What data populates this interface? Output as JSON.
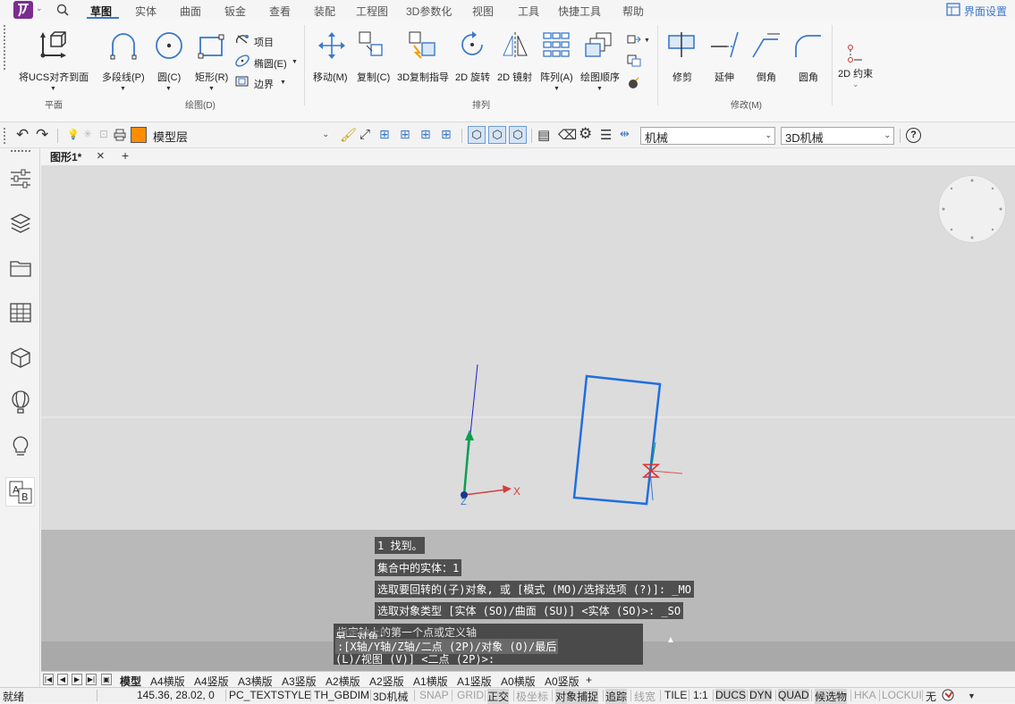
{
  "menu": {
    "items": [
      "草图",
      "实体",
      "曲面",
      "钣金",
      "查看",
      "装配",
      "工程图",
      "3D参数化",
      "视图",
      "工具",
      "快捷工具",
      "帮助"
    ],
    "settings": "界面设置"
  },
  "ribbon": {
    "ucs": "将UCS对齐到面",
    "polyline": "多段线(P)",
    "circle": "圆(C)",
    "rect": "矩形(R)",
    "item": "项目",
    "ellipse": "椭圆(E)",
    "boundary": "边界",
    "move": "移动(M)",
    "copy": "复制(C)",
    "copy3d": "3D复制指导",
    "rotate2d": "2D 旋转",
    "mirror2d": "2D 镜射",
    "array": "阵列(A)",
    "draworder": "绘图顺序",
    "trim": "修剪",
    "extend": "延伸",
    "chamfer": "倒角",
    "fillet": "圆角",
    "constraint": "2D 约束",
    "group_plane": "平面",
    "group_draw": "绘图(D)",
    "group_arrange": "排列",
    "group_modify": "修改(M)"
  },
  "toolbar": {
    "layer": "模型层",
    "style": "机械",
    "visual": "3D机械"
  },
  "doc_tabs": {
    "active": "图形1*",
    "close": "×",
    "add": "+"
  },
  "canvas": {
    "axis_x": "X",
    "axis_z": "Z"
  },
  "command": {
    "lines": [
      "1 找到。",
      "集合中的实体：1",
      "选取要回转的(子)对象, 或 [模式 (MO)/选择选项 (?)]: _MO",
      "选取对象类型 [实体 (SO)/曲面 (SU)] <实体 (SO)>: _SO"
    ],
    "prompt_line1": "指定轴上的第一个点或定义轴",
    "prompt_line2": "另一对角:",
    "prompt_line3": ":[X轴/Y轴/Z轴/二点 (2P)/对象 (O)/最后",
    "prompt_line4": "(L)/视图 (V)] <二点 (2P)>:",
    "expand_arrow": "▲"
  },
  "layouts": {
    "tabs": [
      "模型",
      "A4横版",
      "A4竖版",
      "A3横版",
      "A3竖版",
      "A2横版",
      "A2竖版",
      "A1横版",
      "A1竖版",
      "A0横版",
      "A0竖版"
    ],
    "add": "+"
  },
  "status": {
    "ready": "就绪",
    "coords": "145.36, 28.02, 0",
    "textstyle": "PC_TEXTSTYLE",
    "dimstyle": "TH_GBDIM",
    "visual": "3D机械",
    "snap": "SNAP",
    "grid": "GRID",
    "ortho": "正交",
    "polar": "极坐标",
    "osnap": "对象捕捉",
    "otrack": "追踪",
    "lweight": "线宽",
    "tile": "TILE",
    "scale": "1:1",
    "ducs": "DUCS",
    "dyn": "DYN",
    "quad": "QUAD",
    "candidate": "候选物",
    "hka": "HKA",
    "lockui": "LOCKUI",
    "none": "无"
  },
  "colors": {
    "accent": "#3a78c9",
    "shape": "#1f6fe0",
    "layer": "#ff8c00"
  }
}
